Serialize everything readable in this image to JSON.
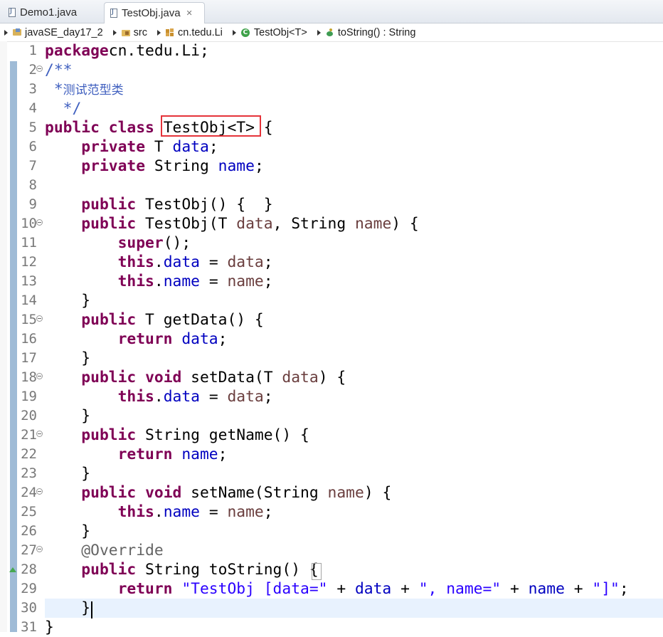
{
  "tabs": [
    {
      "label": "Demo1.java",
      "active": false
    },
    {
      "label": "TestObj.java",
      "active": true,
      "close": "✕"
    }
  ],
  "breadcrumb": [
    {
      "label": "javaSE_day17_2",
      "icon": "project-icon"
    },
    {
      "label": "src",
      "icon": "source-folder-icon"
    },
    {
      "label": "cn.tedu.Li",
      "icon": "package-icon"
    },
    {
      "label": "TestObj<T>",
      "icon": "class-icon"
    },
    {
      "label": "toString() : String",
      "icon": "method-icon"
    }
  ],
  "class_icon_letter": "C",
  "editor": {
    "current_line": 30,
    "highlighted_text": "TestObj<T>",
    "colors": {
      "keyword": "#7f0055",
      "field": "#0000c0",
      "string": "#2a00ff",
      "comment": "#3f5fbf",
      "highlight_box": "#e5333a"
    },
    "lines": [
      {
        "n": "1",
        "tokens": [
          [
            "kw",
            "package"
          ],
          [
            "",
            "cn.tedu.Li;"
          ]
        ]
      },
      {
        "n": "2",
        "fold": true,
        "tokens": [
          [
            "cmt",
            "/**"
          ]
        ]
      },
      {
        "n": "3",
        "tokens": [
          [
            "cmt",
            " *"
          ],
          [
            "cmt zh",
            "测试范型类"
          ]
        ]
      },
      {
        "n": "4",
        "tokens": [
          [
            "cmt",
            "  */"
          ]
        ]
      },
      {
        "n": "5",
        "tokens": [
          [
            "kw",
            "public"
          ],
          [
            "",
            " "
          ],
          [
            "kw",
            "class"
          ],
          [
            "",
            " TestObj<T> {"
          ]
        ]
      },
      {
        "n": "6",
        "tokens": [
          [
            "",
            "    "
          ],
          [
            "kw",
            "private"
          ],
          [
            "",
            " T "
          ],
          [
            "fld",
            "data"
          ],
          [
            "",
            ";"
          ]
        ]
      },
      {
        "n": "7",
        "tokens": [
          [
            "",
            "    "
          ],
          [
            "kw",
            "private"
          ],
          [
            "",
            " String "
          ],
          [
            "fld",
            "name"
          ],
          [
            "",
            ";"
          ]
        ]
      },
      {
        "n": "8",
        "tokens": [
          [
            "",
            ""
          ]
        ]
      },
      {
        "n": "9",
        "tokens": [
          [
            "",
            "    "
          ],
          [
            "kw",
            "public"
          ],
          [
            "",
            " TestObj() {  }"
          ]
        ]
      },
      {
        "n": "10",
        "fold": true,
        "tokens": [
          [
            "",
            "    "
          ],
          [
            "kw",
            "public"
          ],
          [
            "",
            " TestObj(T "
          ],
          [
            "par",
            "data"
          ],
          [
            "",
            ", String "
          ],
          [
            "par",
            "name"
          ],
          [
            "",
            ") {"
          ]
        ]
      },
      {
        "n": "11",
        "tokens": [
          [
            "",
            "        "
          ],
          [
            "kw",
            "super"
          ],
          [
            "",
            "();"
          ]
        ]
      },
      {
        "n": "12",
        "tokens": [
          [
            "",
            "        "
          ],
          [
            "kw",
            "this"
          ],
          [
            "",
            "."
          ],
          [
            "fld",
            "data"
          ],
          [
            "",
            " = "
          ],
          [
            "par",
            "data"
          ],
          [
            "",
            ";"
          ]
        ]
      },
      {
        "n": "13",
        "tokens": [
          [
            "",
            "        "
          ],
          [
            "kw",
            "this"
          ],
          [
            "",
            "."
          ],
          [
            "fld",
            "name"
          ],
          [
            "",
            " = "
          ],
          [
            "par",
            "name"
          ],
          [
            "",
            ";"
          ]
        ]
      },
      {
        "n": "14",
        "tokens": [
          [
            "",
            "    }"
          ]
        ]
      },
      {
        "n": "15",
        "fold": true,
        "tokens": [
          [
            "",
            "    "
          ],
          [
            "kw",
            "public"
          ],
          [
            "",
            " T getData() {"
          ]
        ]
      },
      {
        "n": "16",
        "tokens": [
          [
            "",
            "        "
          ],
          [
            "kw",
            "return"
          ],
          [
            "",
            " "
          ],
          [
            "fld",
            "data"
          ],
          [
            "",
            ";"
          ]
        ]
      },
      {
        "n": "17",
        "tokens": [
          [
            "",
            "    }"
          ]
        ]
      },
      {
        "n": "18",
        "fold": true,
        "tokens": [
          [
            "",
            "    "
          ],
          [
            "kw",
            "public"
          ],
          [
            "",
            " "
          ],
          [
            "kw",
            "void"
          ],
          [
            "",
            " setData(T "
          ],
          [
            "par",
            "data"
          ],
          [
            "",
            ") {"
          ]
        ]
      },
      {
        "n": "19",
        "tokens": [
          [
            "",
            "        "
          ],
          [
            "kw",
            "this"
          ],
          [
            "",
            "."
          ],
          [
            "fld",
            "data"
          ],
          [
            "",
            " = "
          ],
          [
            "par",
            "data"
          ],
          [
            "",
            ";"
          ]
        ]
      },
      {
        "n": "20",
        "tokens": [
          [
            "",
            "    }"
          ]
        ]
      },
      {
        "n": "21",
        "fold": true,
        "tokens": [
          [
            "",
            "    "
          ],
          [
            "kw",
            "public"
          ],
          [
            "",
            " String getName() {"
          ]
        ]
      },
      {
        "n": "22",
        "tokens": [
          [
            "",
            "        "
          ],
          [
            "kw",
            "return"
          ],
          [
            "",
            " "
          ],
          [
            "fld",
            "name"
          ],
          [
            "",
            ";"
          ]
        ]
      },
      {
        "n": "23",
        "tokens": [
          [
            "",
            "    }"
          ]
        ]
      },
      {
        "n": "24",
        "fold": true,
        "tokens": [
          [
            "",
            "    "
          ],
          [
            "kw",
            "public"
          ],
          [
            "",
            " "
          ],
          [
            "kw",
            "void"
          ],
          [
            "",
            " setName(String "
          ],
          [
            "par",
            "name"
          ],
          [
            "",
            ") {"
          ]
        ]
      },
      {
        "n": "25",
        "tokens": [
          [
            "",
            "        "
          ],
          [
            "kw",
            "this"
          ],
          [
            "",
            "."
          ],
          [
            "fld",
            "name"
          ],
          [
            "",
            " = "
          ],
          [
            "par",
            "name"
          ],
          [
            "",
            ";"
          ]
        ]
      },
      {
        "n": "26",
        "tokens": [
          [
            "",
            "    }"
          ]
        ]
      },
      {
        "n": "27",
        "fold": true,
        "tokens": [
          [
            "",
            "    "
          ],
          [
            "ann",
            "@Override"
          ]
        ]
      },
      {
        "n": "28",
        "tokens": [
          [
            "",
            "    "
          ],
          [
            "kw",
            "public"
          ],
          [
            "",
            " String toString() {"
          ]
        ]
      },
      {
        "n": "29",
        "tokens": [
          [
            "",
            "        "
          ],
          [
            "kw",
            "return"
          ],
          [
            "",
            " "
          ],
          [
            "str",
            "\"TestObj [data=\""
          ],
          [
            "",
            " + "
          ],
          [
            "fld",
            "data"
          ],
          [
            "",
            " + "
          ],
          [
            "str",
            "\", name=\""
          ],
          [
            "",
            " + "
          ],
          [
            "fld",
            "name"
          ],
          [
            "",
            " + "
          ],
          [
            "str",
            "\"]\""
          ],
          [
            "",
            ";"
          ]
        ]
      },
      {
        "n": "30",
        "tokens": [
          [
            "",
            "    }"
          ]
        ]
      },
      {
        "n": "31",
        "tokens": [
          [
            "",
            "}"
          ]
        ]
      }
    ]
  }
}
